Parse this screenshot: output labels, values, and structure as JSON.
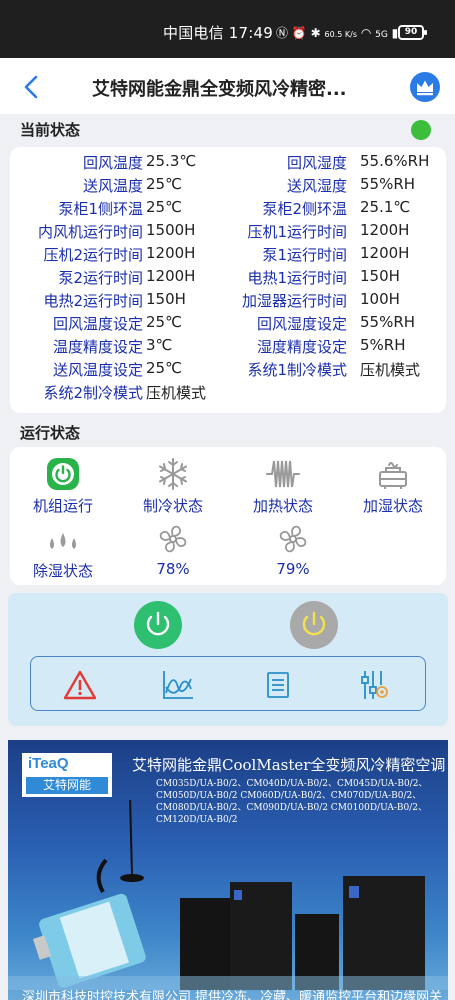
{
  "statusbar": {
    "carrier_time": "中国电信 17:49",
    "net_speed": "60.5 K/s",
    "signal": "5G",
    "battery": "90"
  },
  "nav": {
    "title": "艾特网能金鼎全变频风冷精密..."
  },
  "current_status": {
    "header": "当前状态",
    "dot_color": "#3cbd3c",
    "rows": [
      {
        "l_label": "回风温度",
        "l_value": "25.3℃",
        "r_label": "回风湿度",
        "r_value": "55.6%RH"
      },
      {
        "l_label": "送风温度",
        "l_value": "25℃",
        "r_label": "送风湿度",
        "r_value": "55%RH"
      },
      {
        "l_label": "泵柜1侧环温",
        "l_value": "25℃",
        "r_label": "泵柜2侧环温",
        "r_value": "25.1℃"
      },
      {
        "l_label": "内风机运行时间",
        "l_value": "1500H",
        "r_label": "压机1运行时间",
        "r_value": "1200H"
      },
      {
        "l_label": "压机2运行时间",
        "l_value": "1200H",
        "r_label": "泵1运行时间",
        "r_value": "1200H"
      },
      {
        "l_label": "泵2运行时间",
        "l_value": "1200H",
        "r_label": "电热1运行时间",
        "r_value": "150H"
      },
      {
        "l_label": "电热2运行时间",
        "l_value": "150H",
        "r_label": "加湿器运行时间",
        "r_value": "100H"
      },
      {
        "l_label": "回风温度设定",
        "l_value": "25℃",
        "r_label": "回风湿度设定",
        "r_value": "55%RH"
      },
      {
        "l_label": "温度精度设定",
        "l_value": "3℃",
        "r_label": "湿度精度设定",
        "r_value": "5%RH"
      },
      {
        "l_label": "送风温度设定",
        "l_value": "25℃",
        "r_label": "系统1制冷模式",
        "r_value": "压机模式"
      },
      {
        "l_label": "系统2制冷模式",
        "l_value": "压机模式",
        "r_label": "",
        "r_value": ""
      }
    ]
  },
  "run_status": {
    "header": "运行状态",
    "items": [
      {
        "label": "机组运行",
        "icon": "power-icon"
      },
      {
        "label": "制冷状态",
        "icon": "snowflake-icon"
      },
      {
        "label": "加热状态",
        "icon": "heater-coil-icon"
      },
      {
        "label": "加湿状态",
        "icon": "humidifier-icon"
      },
      {
        "label": "除湿状态",
        "icon": "water-drops-icon"
      },
      {
        "label": "78%",
        "icon": "fan-icon"
      },
      {
        "label": "79%",
        "icon": "fan-icon"
      }
    ]
  },
  "controls": {
    "power_on_color": "#2fbf71",
    "power_off_color": "#a9a9a9",
    "tools": [
      "alarm-icon",
      "trend-chart-icon",
      "list-icon",
      "settings-sliders-icon"
    ]
  },
  "banner": {
    "logo_top": "iTeaQ",
    "logo_bottom": "艾特网能",
    "title": "艾特网能金鼎CoolMaster全变频风冷精密空调",
    "models": "CM035D/UA-B0/2、CM040D/UA-B0/2、CM045D/UA-B0/2、CM050D/UA-B0/2 CM060D/UA-B0/2、CM070D/UA-B0/2、CM080D/UA-B0/2、CM090D/UA-B0/2 CM0100D/UA-B0/2、CM120D/UA-B0/2",
    "footer": "深圳市科技时控技术有限公司    提供冷冻、冷藏、暖通监控平台和边缘网关"
  }
}
